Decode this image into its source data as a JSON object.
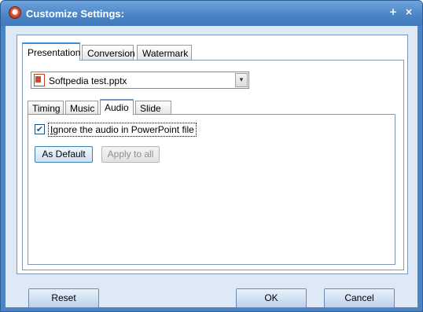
{
  "window": {
    "title": "Customize Settings:",
    "minimize_glyph": "+",
    "close_glyph": "×"
  },
  "outer_tabs": {
    "presentation": "Presentation",
    "conversion": "Conversion",
    "watermark": "Watermark"
  },
  "file_select": {
    "value": "Softpedia test.pptx",
    "icon": "powerpoint-file-icon",
    "dropdown_glyph": "▾"
  },
  "inner_tabs": {
    "timing": "Timing",
    "music": "Music",
    "audio": "Audio",
    "slide": "Slide"
  },
  "audio_panel": {
    "ignore_audio_checked": true,
    "ignore_audio_label": "Ignore the audio in PowerPoint file",
    "check_glyph": "✔",
    "as_default_label": "As Default",
    "apply_to_all_label": "Apply to all"
  },
  "footer": {
    "reset_label": "Reset",
    "ok_label": "OK",
    "cancel_label": "Cancel"
  }
}
